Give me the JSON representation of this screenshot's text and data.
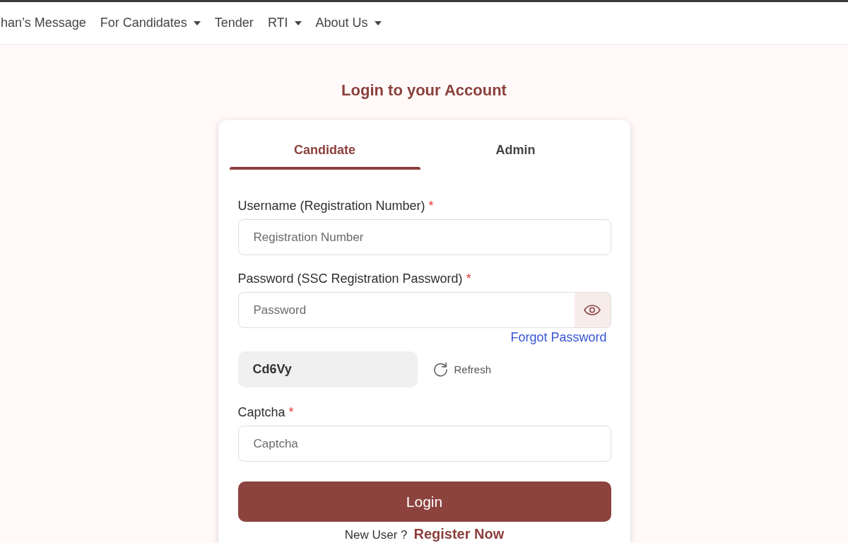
{
  "nav": {
    "items": [
      {
        "label": "han’s Message",
        "dropdown": false
      },
      {
        "label": "For Candidates",
        "dropdown": true
      },
      {
        "label": "Tender",
        "dropdown": false
      },
      {
        "label": "RTI",
        "dropdown": true
      },
      {
        "label": "About Us",
        "dropdown": true
      }
    ]
  },
  "login": {
    "title": "Login to your Account",
    "tabs": [
      {
        "label": "Candidate",
        "selected": true
      },
      {
        "label": "Admin",
        "selected": false
      }
    ],
    "fields": [
      {
        "kind": "text",
        "label": "Username (Registration Number)",
        "required_mark": "*",
        "placeholder": "Registration Number"
      },
      {
        "kind": "password",
        "label": "Password (SSC Registration Password)",
        "required_mark": "*",
        "placeholder": "Password",
        "link": "Forgot Password"
      },
      {
        "kind": "captcha",
        "code": "Cd6Vy",
        "action": "Refresh"
      },
      {
        "kind": "text",
        "label": "Captcha",
        "required_mark": "*",
        "placeholder": "Captcha"
      }
    ],
    "submit": "Login",
    "footer": {
      "prompt": "New User ?",
      "link": "Register Now"
    }
  }
}
